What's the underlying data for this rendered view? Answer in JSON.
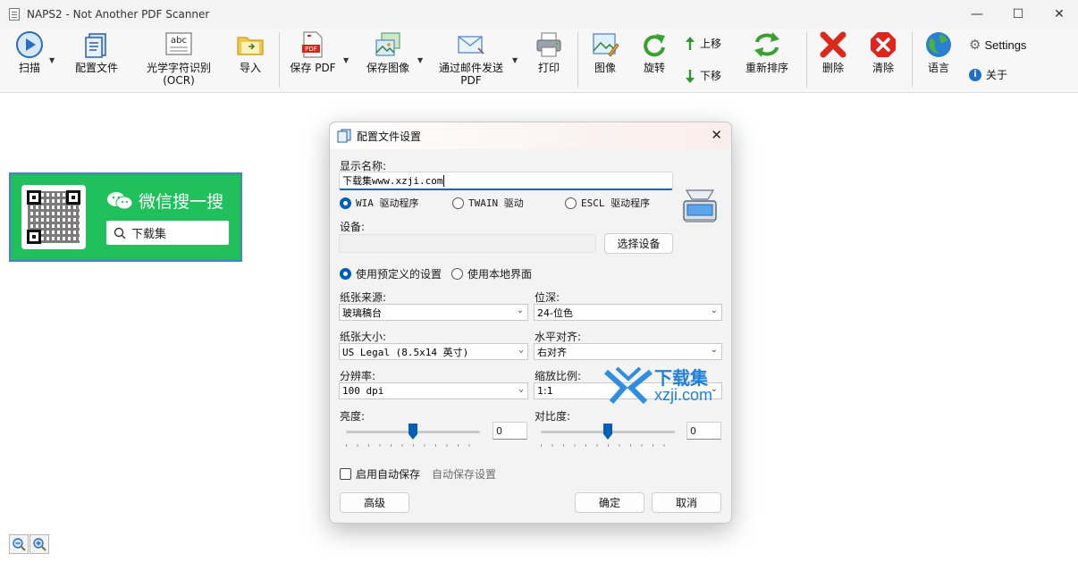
{
  "window": {
    "title": "NAPS2 - Not Another PDF Scanner"
  },
  "toolbar": {
    "scan": "扫描",
    "profiles": "配置文件",
    "ocr_line1": "光学字符识别",
    "ocr_line2": "(OCR)",
    "ocr_icon_text": "abc",
    "import": "导入",
    "save_pdf": "保存 PDF",
    "save_images": "保存图像",
    "email_line1": "通过邮件发送",
    "email_line2": "PDF",
    "print": "打印",
    "image": "图像",
    "rotate": "旋转",
    "move_up": "上移",
    "move_down": "下移",
    "reorder": "重新排序",
    "delete": "删除",
    "clear": "清除",
    "language": "语言",
    "settings": "Settings",
    "about": "关于"
  },
  "thumbnail": {
    "wechat_text": "微信搜一搜",
    "search_text": "下载集"
  },
  "dialog": {
    "title": "配置文件设置",
    "display_name_label": "显示名称:",
    "display_name_value": "下载集www.xzji.com",
    "driver_wia": "WIA 驱动程序",
    "driver_twain": "TWAIN 驱动",
    "driver_escl": "ESCL 驱动程序",
    "device_label": "设备:",
    "choose_device": "选择设备",
    "use_predefined": "使用预定义的设置",
    "use_native_ui": "使用本地界面",
    "paper_source_label": "纸张来源:",
    "paper_source_value": "玻璃稿台",
    "bit_depth_label": "位深:",
    "bit_depth_value": "24-位色",
    "page_size_label": "纸张大小:",
    "page_size_value": "US Legal (8.5x14 英寸)",
    "h_align_label": "水平对齐:",
    "h_align_value": "右对齐",
    "resolution_label": "分辨率:",
    "resolution_value": "100 dpi",
    "scale_label": "缩放比例:",
    "scale_value": "1:1",
    "brightness_label": "亮度:",
    "brightness_value": "0",
    "brightness_level": 0.5,
    "contrast_label": "对比度:",
    "contrast_value": "0",
    "contrast_level": 0.5,
    "auto_save": "启用自动保存",
    "auto_save_settings": "自动保存设置",
    "advanced": "高级",
    "ok": "确定",
    "cancel": "取消"
  },
  "watermark": {
    "cn": "下载集",
    "url": "xzji.com"
  },
  "colors": {
    "accent": "#005fb8",
    "wechat_green": "#20c05c"
  }
}
